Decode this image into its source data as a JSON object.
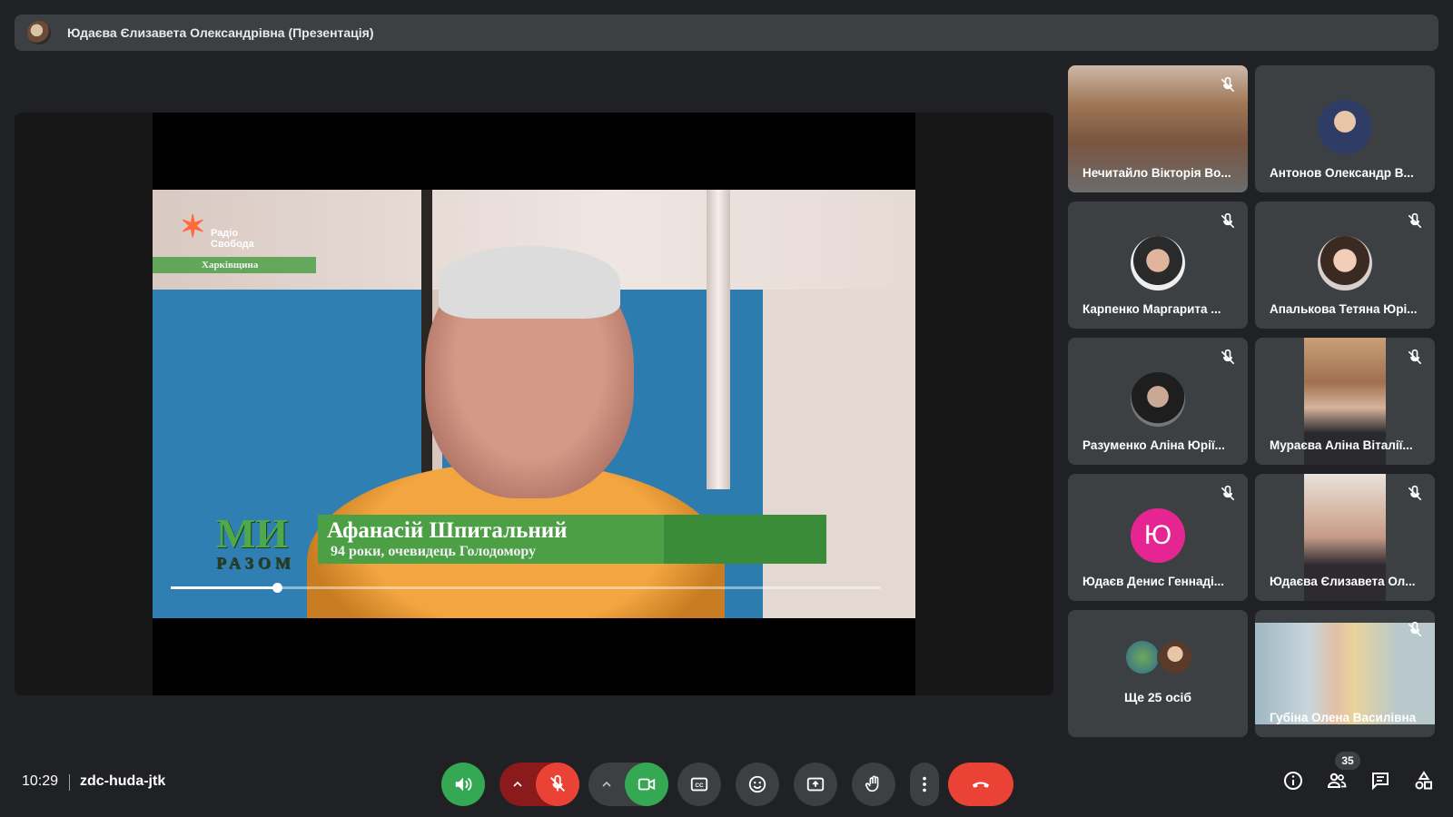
{
  "header": {
    "presenter_title": "Юдаєва Єлизавета Олександрівна (Презентація)"
  },
  "presentation": {
    "logo_text": "Радіо Свобода",
    "region_text": "Харківщина",
    "show_logo": "МИ",
    "show_logo_sub": "РАЗОМ",
    "caption_name": "Афанасій Шпитальний",
    "caption_sub": "94 роки, очевидець Голодомору",
    "progress_fraction": 0.15
  },
  "participants": [
    {
      "name": "Нечитайло Вікторія Во...",
      "muted": true,
      "type": "camera"
    },
    {
      "name": "Антонов Олександр В...",
      "muted": false,
      "type": "avatar"
    },
    {
      "name": "Карпенко Маргарита ...",
      "muted": true,
      "type": "avatar"
    },
    {
      "name": "Апалькова Тетяна Юрі...",
      "muted": true,
      "type": "avatar"
    },
    {
      "name": "Разуменко Аліна Юрії...",
      "muted": true,
      "type": "avatar"
    },
    {
      "name": "Мураєва Аліна Віталії...",
      "muted": true,
      "type": "camera"
    },
    {
      "name": "Юдаєв Денис Геннаді...",
      "muted": true,
      "type": "initial",
      "initial": "Ю",
      "color": "#e52592"
    },
    {
      "name": "Юдаєва Єлизавета Ол...",
      "muted": true,
      "type": "camera"
    },
    {
      "name": "Губіна Олена Василівна",
      "muted": true,
      "type": "camera"
    }
  ],
  "more_tile": {
    "label": "Ще 25 осіб"
  },
  "footer": {
    "time": "10:29",
    "meeting_code": "zdc-huda-jtk",
    "participant_count": "35"
  },
  "colors": {
    "end_call": "#ea4335",
    "mic_off": "#ea4335",
    "active_green": "#34a853",
    "tile_bg": "#3c4043",
    "page_bg": "#202124"
  }
}
